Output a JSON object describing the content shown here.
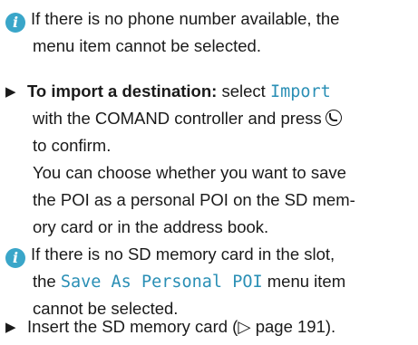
{
  "note1": {
    "icon": "info-icon",
    "line1": "If there is no phone number available, the",
    "line2": "menu item cannot be selected."
  },
  "step_import": {
    "bullet_icon": "triangle-right-icon",
    "heading": "To import a destination:",
    "text_a": " select ",
    "menu_item": "Import",
    "line2_text": "with the COMAND controller and press",
    "press_icon": "controller-press-icon",
    "line3": "to confirm.",
    "para2_line1": "You can choose whether you want to save",
    "para2_line2": "the POI as a personal POI on the SD mem-",
    "para2_line3": "ory card or in the address book."
  },
  "note2": {
    "icon": "info-icon",
    "line1": "If there is no SD memory card in the slot,",
    "line2_pre": "the ",
    "menu_item": "Save As Personal POI",
    "line2_post": " menu item",
    "line3": "cannot be selected."
  },
  "step_insert": {
    "bullet_icon": "triangle-right-icon",
    "text": "Insert the SD memory card (▷ page 191)."
  }
}
